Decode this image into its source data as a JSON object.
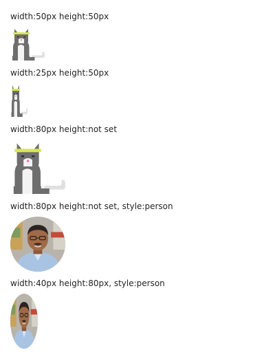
{
  "samples": [
    {
      "label": "width:50px height:50px",
      "image": "cat-illustration"
    },
    {
      "label": "width:25px height:50px",
      "image": "cat-illustration"
    },
    {
      "label": "width:80px height:not set",
      "image": "cat-illustration"
    },
    {
      "label": "width:80px height:not set, style:person",
      "image": "person-photo"
    },
    {
      "label": "width:40px height:80px, style:person",
      "image": "person-photo"
    }
  ]
}
